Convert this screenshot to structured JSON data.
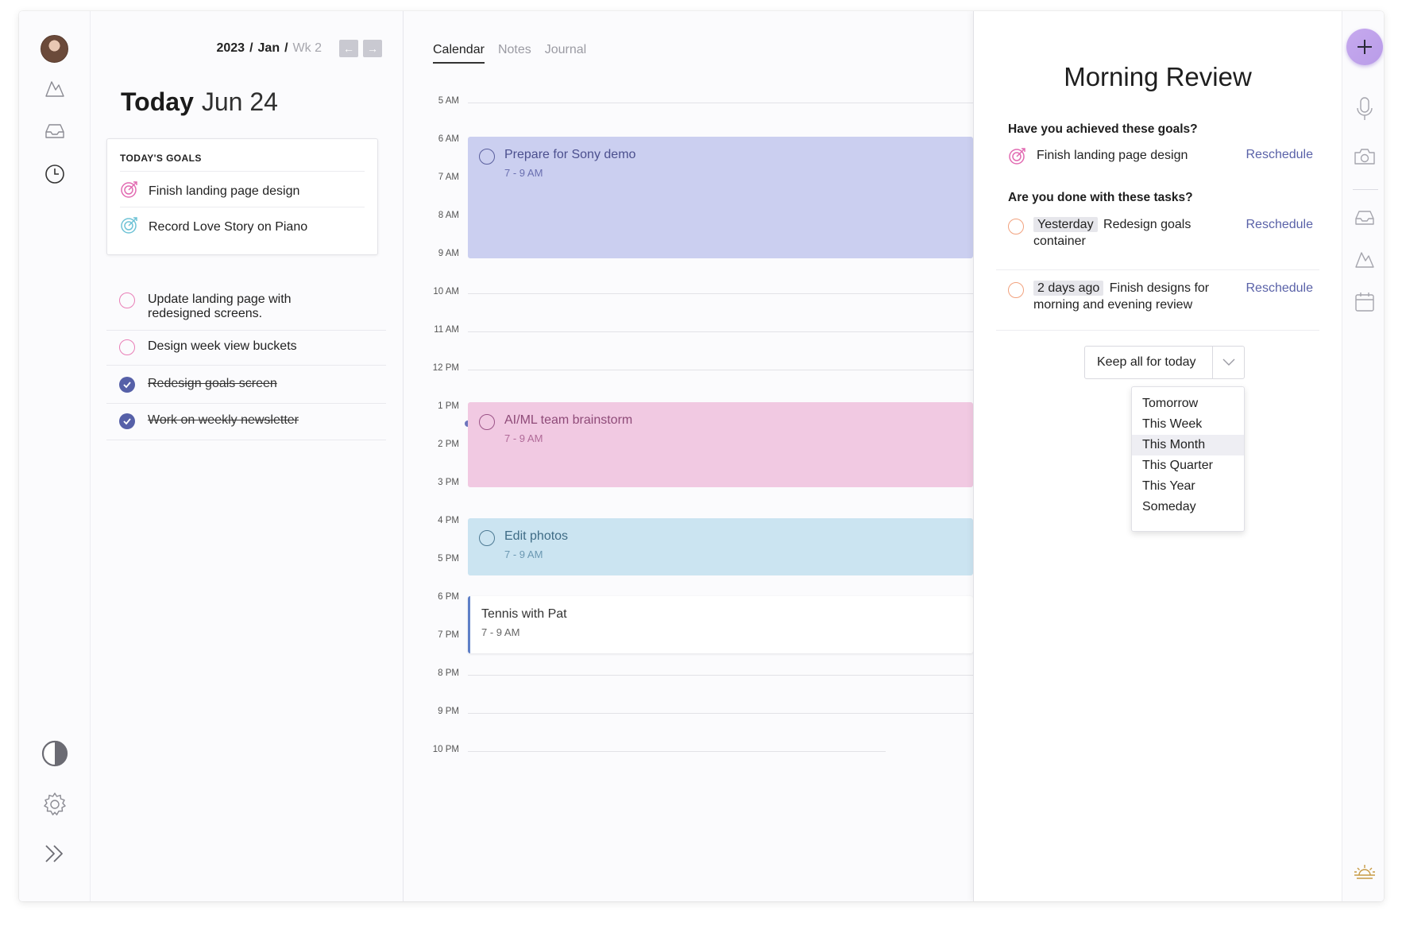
{
  "header": {
    "year": "2023",
    "month": "Jan",
    "week": "Wk 2",
    "prev_arrow": "←",
    "next_arrow": "→"
  },
  "today": {
    "word": "Today",
    "date": "Jun 24"
  },
  "goals": {
    "heading": "TODAY'S GOALS",
    "items": [
      {
        "label": "Finish landing page design",
        "color": "#e26bb2"
      },
      {
        "label": "Record Love Story on Piano",
        "color": "#6fc3d6"
      }
    ]
  },
  "tasks": [
    {
      "label": "Update landing page with redesigned screens.",
      "done": false
    },
    {
      "label": "Design week view buckets",
      "done": false
    },
    {
      "label": "Redesign goals screen",
      "done": true
    },
    {
      "label": "Work on weekly newsletter",
      "done": true
    }
  ],
  "calendar": {
    "tabs": [
      "Calendar",
      "Notes",
      "Journal"
    ],
    "active_tab": "Calendar",
    "hours": [
      "5 AM",
      "6 AM",
      "7 AM",
      "8 AM",
      "9 AM",
      "10 AM",
      "11 AM",
      "12 PM",
      "1 PM",
      "2 PM",
      "3 PM",
      "4 PM",
      "5 PM",
      "6 PM",
      "7 PM",
      "8 PM",
      "9 PM",
      "10 PM"
    ],
    "events": [
      {
        "title": "Prepare for Sony demo",
        "time": "7 - 9 AM",
        "bg": "#cbcff0",
        "fg": "#4b4f8e"
      },
      {
        "title": "AI/ML team brainstorm",
        "time": "7 - 9 AM",
        "bg": "#f1c9e2",
        "fg": "#8e4a78"
      },
      {
        "title": "Edit photos",
        "time": "7 - 9 AM",
        "bg": "#cbe4f1",
        "fg": "#3f6c86"
      },
      {
        "title": "Tennis with Pat",
        "time": "7 - 9 AM",
        "bg": "#ffffff",
        "fg": "#333333"
      }
    ]
  },
  "review": {
    "title": "Morning Review",
    "goals_question": "Have you achieved these goals?",
    "goal_item": "Finish landing page design",
    "tasks_question": "Are you done with these tasks?",
    "task_items": [
      {
        "when": "Yesterday",
        "text": "Redesign goals container"
      },
      {
        "when": "2 days ago",
        "text": "Finish designs for morning and evening review"
      }
    ],
    "reschedule": "Reschedule",
    "keep_label": "Keep all for today",
    "menu": [
      "Tomorrow",
      "This Week",
      "This Month",
      "This Quarter",
      "This Year",
      "Someday"
    ],
    "menu_selected": "This Month"
  },
  "colors": {
    "accent": "#5a62a8",
    "plus_button": "#c2a6ee",
    "now_line": "#6d75bd"
  },
  "icons": {
    "left_rail": [
      "avatar",
      "mountain-icon",
      "inbox-icon",
      "clock-icon",
      "contrast-icon",
      "gear-icon",
      "double-chevron-right-icon"
    ],
    "right_rail": [
      "plus-icon",
      "microphone-icon",
      "camera-icon",
      "inbox-icon",
      "mountain-icon",
      "calendar-icon",
      "sunrise-icon"
    ]
  }
}
